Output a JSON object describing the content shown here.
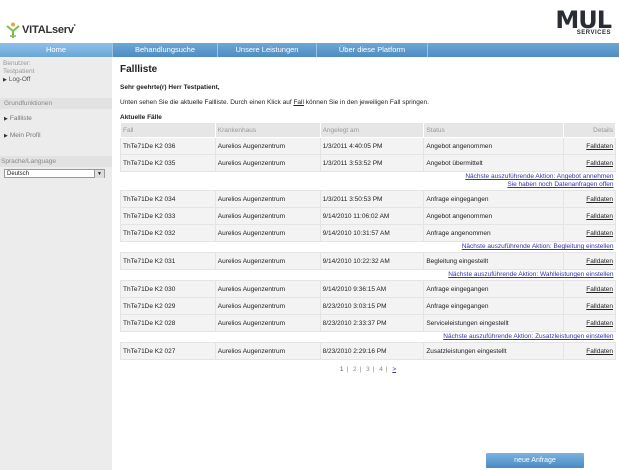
{
  "header": {
    "logo_text": "VITALserv",
    "logo_tm": "*",
    "brand_mark": "MUL",
    "brand_sub": "SERVICES"
  },
  "nav": {
    "items": [
      {
        "label": "Home"
      },
      {
        "label": "Behandlungsuche"
      },
      {
        "label": "Unsere Leistungen"
      },
      {
        "label": "Über diese Platform"
      }
    ]
  },
  "sidebar": {
    "user_label": "Benutzer:",
    "user_name": "Testpatient",
    "logoff": "Log-Off",
    "group_label": "Grundfunktionen",
    "items": [
      {
        "label": "Fallliste"
      },
      {
        "label": "Mein Profil"
      }
    ],
    "language_label": "Sprache/Language",
    "language_value": "Deutsch"
  },
  "main": {
    "title": "Fallliste",
    "greeting": "Sehr geehrte(r) Herr Testpatient,",
    "intro_before": "Unten sehen Sie die aktuelle Fallliste. Durch einen Klick auf ",
    "intro_link": "Fall",
    "intro_after": " können Sie in den jeweiligen Fall springen.",
    "subtitle": "Aktuelle Fälle",
    "columns": [
      "Fall",
      "Krankenhaus",
      "Angelegt am",
      "Status",
      "Details"
    ],
    "rows": [
      {
        "fall": "ThTe71De K2 036",
        "hospital": "Aurelios Augenzentrum",
        "date": "1/3/2011 4:40:05 PM",
        "status": "Angebot angenommen",
        "details": "Falldaten",
        "actions": []
      },
      {
        "fall": "ThTe71De K2 035",
        "hospital": "Aurelios Augenzentrum",
        "date": "1/3/2011 3:53:52 PM",
        "status": "Angebot übermittelt",
        "details": "Falldaten",
        "actions": [
          "Nächste auszuführende Aktion: Angebot annehmen",
          "Sie haben noch Datenanfragen offen"
        ]
      },
      {
        "fall": "ThTe71De K2 034",
        "hospital": "Aurelios Augenzentrum",
        "date": "1/3/2011 3:50:53 PM",
        "status": "Anfrage eingegangen",
        "details": "Falldaten",
        "actions": []
      },
      {
        "fall": "ThTe71De K2 033",
        "hospital": "Aurelios Augenzentrum",
        "date": "9/14/2010 11:06:02 AM",
        "status": "Angebot angenommen",
        "details": "Falldaten",
        "actions": []
      },
      {
        "fall": "ThTe71De K2 032",
        "hospital": "Aurelios Augenzentrum",
        "date": "9/14/2010 10:31:57 AM",
        "status": "Anfrage angenommen",
        "details": "Falldaten",
        "actions": [
          "Nächste auszuführende Aktion: Begleitung einstellen"
        ]
      },
      {
        "fall": "ThTe71De K2 031",
        "hospital": "Aurelios Augenzentrum",
        "date": "9/14/2010 10:22:32 AM",
        "status": "Begleitung eingestellt",
        "details": "Falldaten",
        "actions": [
          "Nächste auszuführende Aktion: Wahlleistungen einstellen"
        ]
      },
      {
        "fall": "ThTe71De K2 030",
        "hospital": "Aurelios Augenzentrum",
        "date": "9/14/2010 9:36:15 AM",
        "status": "Anfrage eingegangen",
        "details": "Falldaten",
        "actions": []
      },
      {
        "fall": "ThTe71De K2 029",
        "hospital": "Aurelios Augenzentrum",
        "date": "8/23/2010 3:03:15 PM",
        "status": "Anfrage eingegangen",
        "details": "Falldaten",
        "actions": []
      },
      {
        "fall": "ThTe71De K2 028",
        "hospital": "Aurelios Augenzentrum",
        "date": "8/23/2010 2:33:37 PM",
        "status": "Serviceleistungen eingestellt",
        "details": "Falldaten",
        "actions": [
          "Nächste auszuführende Aktion: Zusatzleistungen einstellen"
        ]
      },
      {
        "fall": "ThTe71De K2 027",
        "hospital": "Aurelios Augenzentrum",
        "date": "8/23/2010 2:29:16 PM",
        "status": "Zusatzleistungen eingestellt",
        "details": "Falldaten",
        "actions": []
      }
    ],
    "pager": {
      "pages": [
        "1",
        "2",
        "3",
        "4"
      ],
      "current": "1",
      "next": ">"
    }
  },
  "new_request_label": "neue Anfrage",
  "colors": {
    "nav_blue": "#5a97cc",
    "link": "#3333aa",
    "sidebar_bg": "#ececec"
  }
}
